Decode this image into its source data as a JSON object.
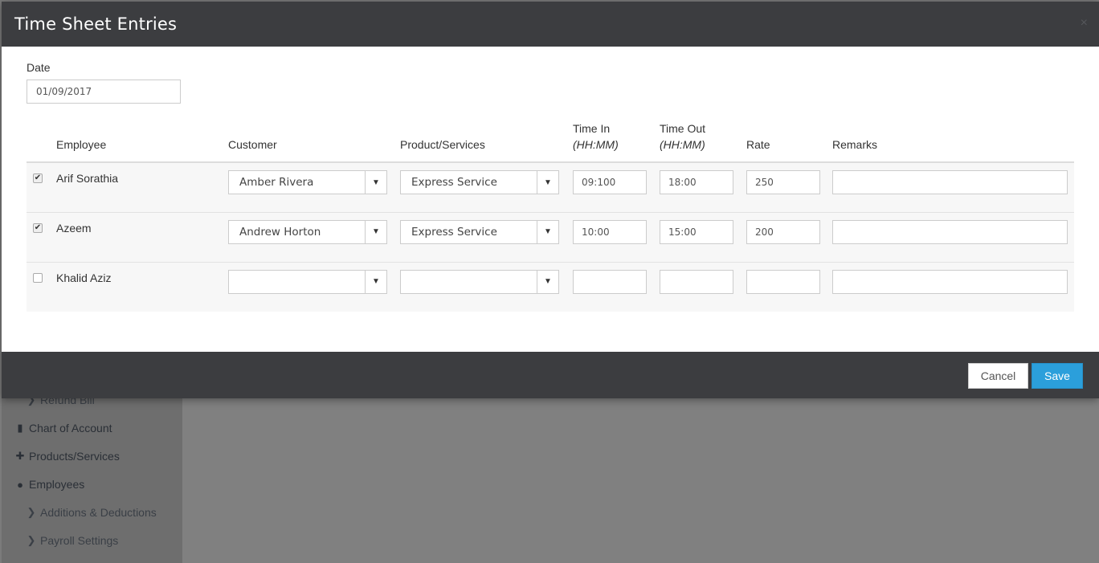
{
  "modal": {
    "title": "Time Sheet Entries",
    "close_glyph": "×",
    "date_label": "Date",
    "date_value": "01/09/2017",
    "columns": {
      "employee": "Employee",
      "customer": "Customer",
      "product": "Product/Services",
      "time_in": "Time In",
      "time_in_sub": "(HH:MM)",
      "time_out": "Time Out",
      "time_out_sub": "(HH:MM)",
      "rate": "Rate",
      "remarks": "Remarks"
    },
    "rows": [
      {
        "checked": true,
        "employee": "Arif Sorathia",
        "customer": "Amber Rivera",
        "product": "Express Service",
        "time_in": "09:100",
        "time_out": "18:00",
        "rate": "250",
        "remarks": ""
      },
      {
        "checked": true,
        "employee": "Azeem",
        "customer": "Andrew Horton",
        "product": "Express Service",
        "time_in": "10:00",
        "time_out": "15:00",
        "rate": "200",
        "remarks": ""
      },
      {
        "checked": false,
        "employee": "Khalid Aziz",
        "customer": "",
        "product": "",
        "time_in": "",
        "time_out": "",
        "rate": "",
        "remarks": ""
      }
    ],
    "footer": {
      "cancel_label": "Cancel",
      "save_label": "Save"
    }
  },
  "sidebar": {
    "items": [
      {
        "label": "Refund Bill",
        "icon": "chevron-right-icon",
        "glyph": "❯",
        "sub": true
      },
      {
        "label": "Chart of Account",
        "icon": "book-icon",
        "glyph": "▮",
        "sub": false
      },
      {
        "label": "Products/Services",
        "icon": "gift-icon",
        "glyph": "✚",
        "sub": false
      },
      {
        "label": "Employees",
        "icon": "user-icon",
        "glyph": "●",
        "sub": false
      },
      {
        "label": "Additions & Deductions",
        "icon": "chevron-right-icon",
        "glyph": "❯",
        "sub": true
      },
      {
        "label": "Payroll Settings",
        "icon": "chevron-right-icon",
        "glyph": "❯",
        "sub": true
      }
    ]
  },
  "colors": {
    "header_bg": "#3c3d40",
    "save_button": "#2b9fdb",
    "overlay": "#7b7b7b"
  }
}
